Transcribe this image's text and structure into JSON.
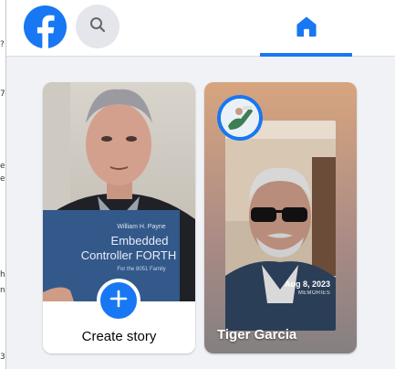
{
  "left_sliver": {
    "fragments": [
      "?",
      "7",
      "e",
      "e",
      "h",
      "n",
      "3"
    ]
  },
  "topbar": {
    "logo_icon": "facebook-logo",
    "search_icon": "search-icon",
    "home_icon": "home-icon",
    "accent": "#1877f2"
  },
  "stories": {
    "create": {
      "label": "Create story",
      "photo_book_lines": [
        "William H. Payne",
        "Embedded",
        "Controller FORTH",
        "For the 8051 Family"
      ]
    },
    "items": [
      {
        "name": "Tiger Garcia",
        "memory_date": "Aug 8, 2023",
        "memory_tag": "MEMORIES"
      }
    ]
  }
}
